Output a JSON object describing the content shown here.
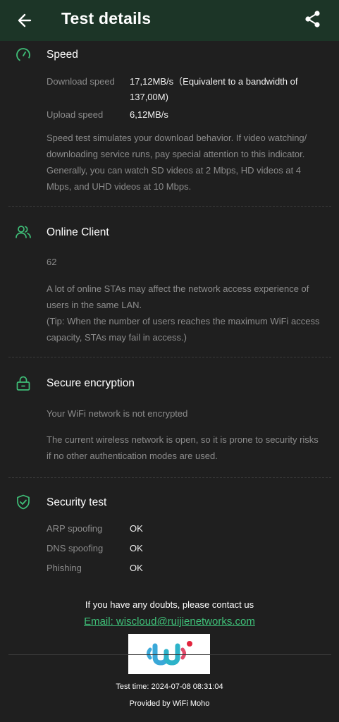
{
  "header": {
    "title": "Test details",
    "back_icon": "arrow-left-icon",
    "share_icon": "share-icon",
    "bg_color": "#1c3527"
  },
  "speed": {
    "title": "Speed",
    "icon": "speedometer-icon",
    "download_label": "Download speed",
    "download_value": "17,12MB/s（Equivalent to a bandwidth of 137,00M)",
    "upload_label": "Upload speed",
    "upload_value": "6,12MB/s",
    "description": "Speed test simulates your download behavior. If video watching/ downloading service runs, pay special attention to this indicator. Generally, you can watch SD videos at 2 Mbps, HD videos at 4 Mbps, and UHD videos at 10 Mbps."
  },
  "online_client": {
    "title": "Online Client",
    "icon": "users-icon",
    "count": "62",
    "description": "A lot of online STAs may affect the network access experience of users in the same LAN.",
    "tip": "(Tip: When the number of users reaches the maximum WiFi access capacity, STAs may fail in access.)"
  },
  "encryption": {
    "title": "Secure encryption",
    "icon": "lock-icon",
    "status": "Your WiFi network is not encrypted",
    "description": "The current wireless network is open, so it is prone to security risks if no other authentication modes are used."
  },
  "security_test": {
    "title": "Security test",
    "icon": "shield-check-icon",
    "items": [
      {
        "label": "ARP spoofing",
        "value": "OK"
      },
      {
        "label": "DNS spoofing",
        "value": "OK"
      },
      {
        "label": "Phishing",
        "value": "OK"
      }
    ]
  },
  "footer": {
    "question": "If you have any doubts, please contact us",
    "email_link": "Email: wiscloud@ruijienetworks.com",
    "logo": "wifi-moho-logo",
    "test_time": "Test time: 2024-07-08 08:31:04",
    "provided_by": "Provided by WiFi Moho",
    "accent_color": "#3fbf78"
  }
}
